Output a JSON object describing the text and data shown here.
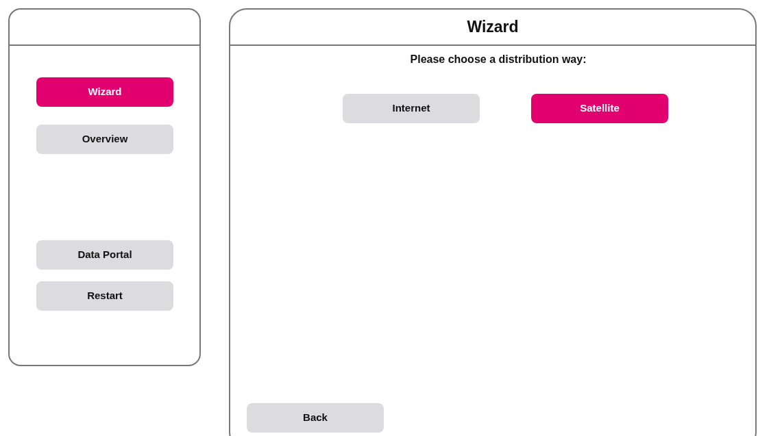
{
  "sidebar": {
    "nav": [
      {
        "label": "Wizard",
        "selected": true
      },
      {
        "label": "Overview",
        "selected": false
      }
    ],
    "actions": [
      {
        "label": "Data Portal"
      },
      {
        "label": "Restart"
      }
    ]
  },
  "main": {
    "title": "Wizard",
    "prompt": "Please choose a distribution way:",
    "options": [
      {
        "label": "Internet",
        "selected": false
      },
      {
        "label": "Satellite",
        "selected": true
      }
    ],
    "back": "Back"
  }
}
